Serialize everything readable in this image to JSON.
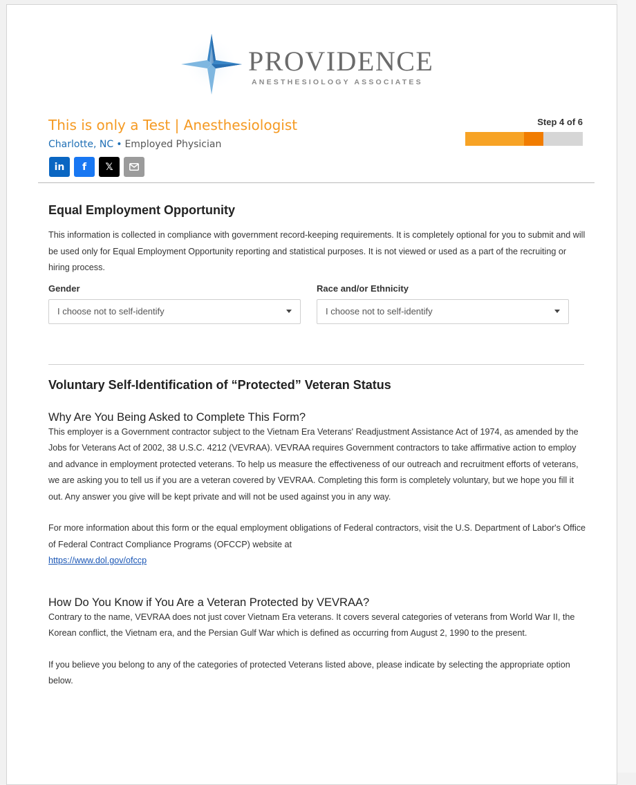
{
  "logo": {
    "name": "PROVIDENCE",
    "tagline": "ANESTHESIOLOGY ASSOCIATES",
    "icon": "compass-star-icon"
  },
  "job": {
    "title": "This is only a Test | Anesthesiologist",
    "location": "Charlotte, NC",
    "separator": "•",
    "type": "Employed Physician"
  },
  "share": [
    {
      "name": "linkedin",
      "label": "in",
      "color": "#0a66c2"
    },
    {
      "name": "facebook",
      "label": "f",
      "color": "#1877f2"
    },
    {
      "name": "x",
      "label": "𝕏",
      "color": "#000000"
    },
    {
      "name": "email",
      "label": "",
      "color": "#9b9b9b"
    }
  ],
  "progress": {
    "label": "Step 4 of 6",
    "current": 4,
    "total": 6,
    "colors": {
      "done": "#f7a325",
      "current": "#f17c00",
      "remaining": "#d6d6d6"
    }
  },
  "eeo": {
    "heading": "Equal Employment Opportunity",
    "intro": "This information is collected in compliance with government record-keeping requirements. It is completely optional for you to submit and will be used only for Equal Employment Opportunity reporting and statistical purposes. It is not viewed or used as a part of the recruiting or hiring process.",
    "gender": {
      "label": "Gender",
      "value": "I choose not to self-identify"
    },
    "race": {
      "label": "Race and/or Ethnicity",
      "value": "I choose not to self-identify"
    }
  },
  "veteran": {
    "heading": "Voluntary Self-Identification of “Protected” Veteran Status",
    "why_heading": "Why Are You Being Asked to Complete This Form?",
    "why_text": "This employer is a Government contractor subject to the Vietnam Era Veterans' Readjustment Assistance Act of 1974, as amended by the Jobs for Veterans Act of 2002, 38 U.S.C. 4212 (VEVRAA). VEVRAA requires Government contractors to take affirmative action to employ and advance in employment protected veterans. To help us measure the effectiveness of our outreach and recruitment efforts of veterans, we are asking you to tell us if you are a veteran covered by VEVRAA. Completing this form is completely voluntary, but we hope you fill it out. Any answer you give will be kept private and will not be used against you in any way.",
    "more_info_text": "For more information about this form or the equal employment obligations of Federal contractors, visit the U.S. Department of Labor's Office of Federal Contract Compliance Programs (OFCCP) website at",
    "more_info_link": "https://www.dol.gov/ofccp",
    "how_heading": "How Do You Know if You Are a Veteran Protected by VEVRAA?",
    "how_text": "Contrary to the name, VEVRAA does not just cover Vietnam Era veterans. It covers several categories of veterans from World War II, the Korean conflict, the Vietnam era, and the Persian Gulf War which is defined as occurring from August 2, 1990 to the present.",
    "believe_text": "If you believe you belong to any of the categories of protected Veterans listed above, please indicate by selecting the appropriate option below."
  }
}
